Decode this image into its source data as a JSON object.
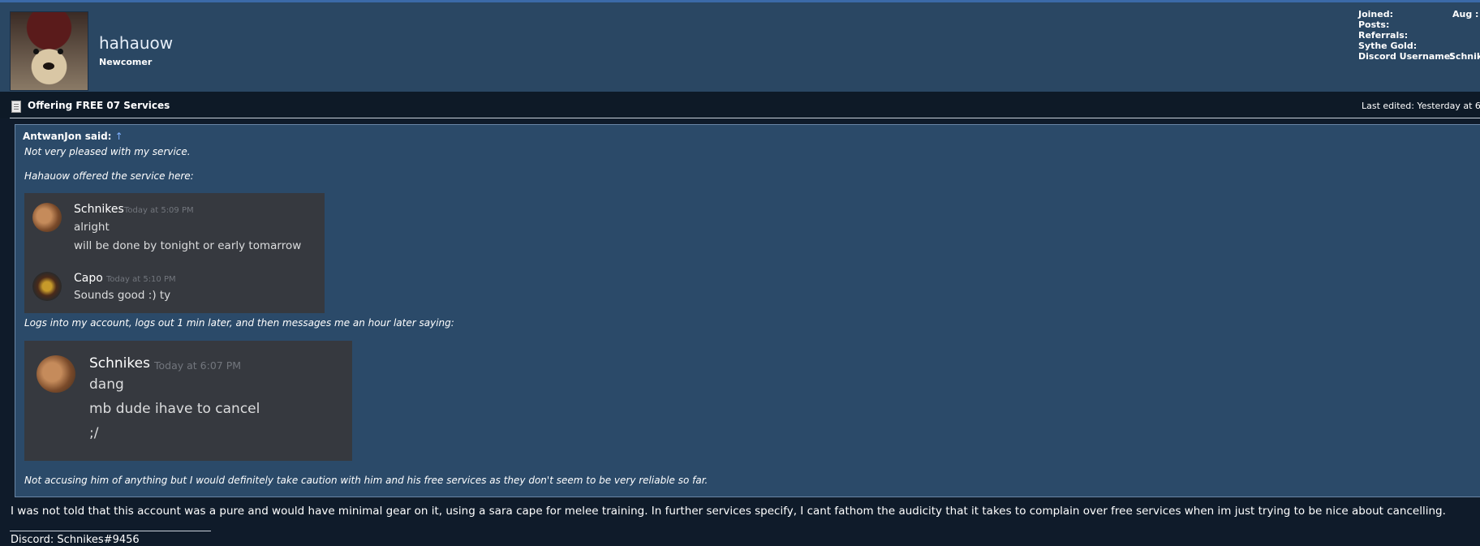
{
  "user": {
    "name": "hahauow",
    "title": "Newcomer",
    "avatar_icon": "doge-avatar-icon",
    "stats": [
      {
        "label": "Joined:",
        "value": "Aug :"
      },
      {
        "label": "Posts:",
        "value": ""
      },
      {
        "label": "Referrals:",
        "value": ""
      },
      {
        "label": "Sythe Gold:",
        "value": ""
      },
      {
        "label": "Discord Username:",
        "value": "Schnike"
      }
    ]
  },
  "post": {
    "title": "Offering FREE 07 Services",
    "title_icon": "document-icon",
    "last_edited": "Last edited: Yesterday at 6",
    "quote": {
      "author": "AntwanJon said:",
      "arrow": "↑",
      "line1": "Not very pleased with my service.",
      "line2": "Hahauow offered the service here:",
      "line3": "Logs into my account, logs out 1 min later, and then messages me an hour later saying:",
      "line4": "Not accusing him of anything but I would definitely take caution with him and his free services as they don't seem to be very reliable so far.",
      "discord1": {
        "messages": [
          {
            "name": "Schnikes",
            "time": "Today at 5:09 PM",
            "lines": [
              "alright",
              "will be done by tonight or early tomarrow"
            ]
          },
          {
            "name": "Capo",
            "time": "Today at 5:10 PM",
            "lines": [
              "Sounds good :) ty"
            ]
          }
        ]
      },
      "discord2": {
        "name": "Schnikes",
        "time": "Today at 6:07 PM",
        "lines": [
          "dang",
          "mb dude ihave to cancel",
          ";/"
        ]
      }
    },
    "body": "I was not told that this account was a pure and would have minimal gear on it, using a sara cape for melee training. In further services specify, I cant fathom the audicity that it takes to complain over free services when im just trying to be nice about cancelling.",
    "signature": "Discord: Schnikes#9456"
  },
  "colors": {
    "header_bg": "#2a4763",
    "quote_bg": "#2b4a69",
    "discord_bg": "#36393f",
    "page_bg": "#0f1b2a"
  }
}
